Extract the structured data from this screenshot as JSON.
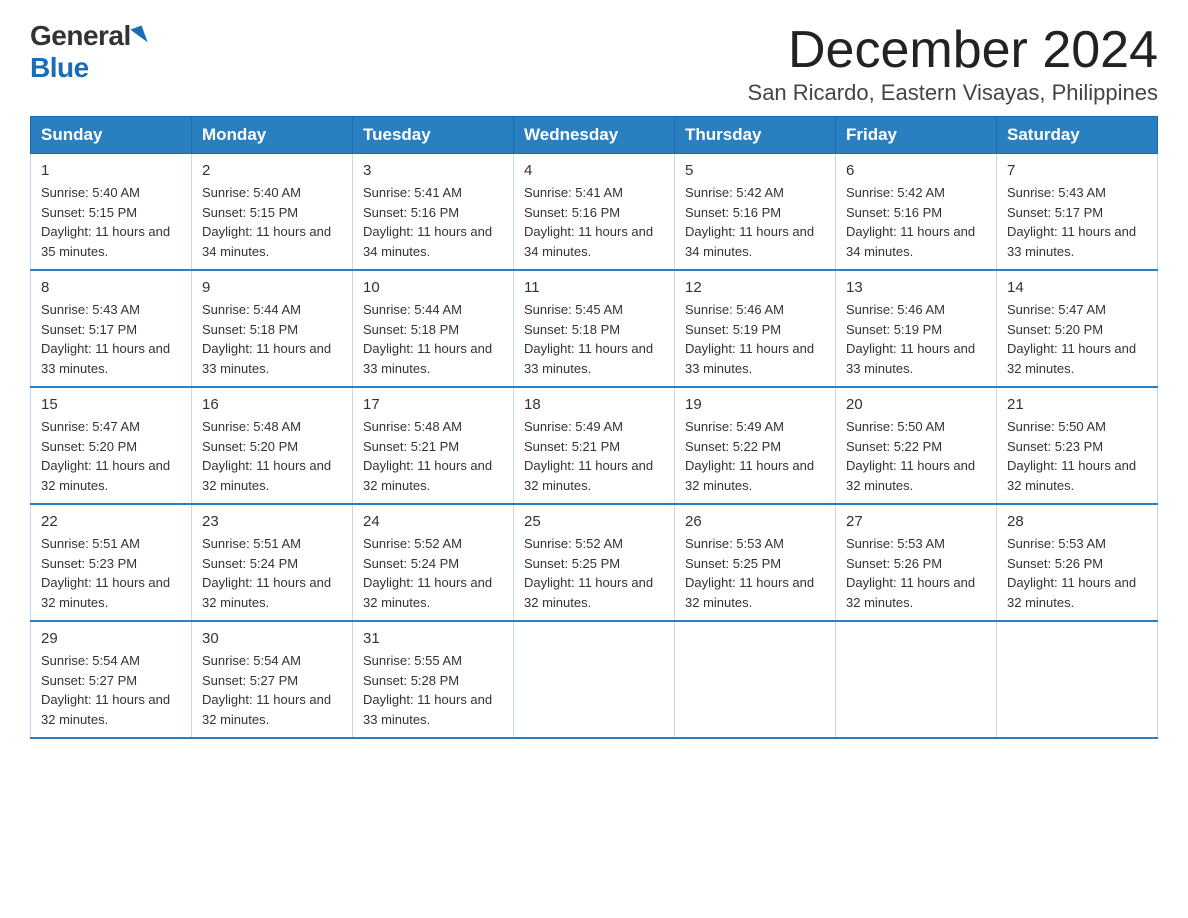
{
  "logo": {
    "general": "General",
    "blue": "Blue"
  },
  "title": "December 2024",
  "location": "San Ricardo, Eastern Visayas, Philippines",
  "days_of_week": [
    "Sunday",
    "Monday",
    "Tuesday",
    "Wednesday",
    "Thursday",
    "Friday",
    "Saturday"
  ],
  "weeks": [
    [
      {
        "day": "1",
        "sunrise": "5:40 AM",
        "sunset": "5:15 PM",
        "daylight": "11 hours and 35 minutes."
      },
      {
        "day": "2",
        "sunrise": "5:40 AM",
        "sunset": "5:15 PM",
        "daylight": "11 hours and 34 minutes."
      },
      {
        "day": "3",
        "sunrise": "5:41 AM",
        "sunset": "5:16 PM",
        "daylight": "11 hours and 34 minutes."
      },
      {
        "day": "4",
        "sunrise": "5:41 AM",
        "sunset": "5:16 PM",
        "daylight": "11 hours and 34 minutes."
      },
      {
        "day": "5",
        "sunrise": "5:42 AM",
        "sunset": "5:16 PM",
        "daylight": "11 hours and 34 minutes."
      },
      {
        "day": "6",
        "sunrise": "5:42 AM",
        "sunset": "5:16 PM",
        "daylight": "11 hours and 34 minutes."
      },
      {
        "day": "7",
        "sunrise": "5:43 AM",
        "sunset": "5:17 PM",
        "daylight": "11 hours and 33 minutes."
      }
    ],
    [
      {
        "day": "8",
        "sunrise": "5:43 AM",
        "sunset": "5:17 PM",
        "daylight": "11 hours and 33 minutes."
      },
      {
        "day": "9",
        "sunrise": "5:44 AM",
        "sunset": "5:18 PM",
        "daylight": "11 hours and 33 minutes."
      },
      {
        "day": "10",
        "sunrise": "5:44 AM",
        "sunset": "5:18 PM",
        "daylight": "11 hours and 33 minutes."
      },
      {
        "day": "11",
        "sunrise": "5:45 AM",
        "sunset": "5:18 PM",
        "daylight": "11 hours and 33 minutes."
      },
      {
        "day": "12",
        "sunrise": "5:46 AM",
        "sunset": "5:19 PM",
        "daylight": "11 hours and 33 minutes."
      },
      {
        "day": "13",
        "sunrise": "5:46 AM",
        "sunset": "5:19 PM",
        "daylight": "11 hours and 33 minutes."
      },
      {
        "day": "14",
        "sunrise": "5:47 AM",
        "sunset": "5:20 PM",
        "daylight": "11 hours and 32 minutes."
      }
    ],
    [
      {
        "day": "15",
        "sunrise": "5:47 AM",
        "sunset": "5:20 PM",
        "daylight": "11 hours and 32 minutes."
      },
      {
        "day": "16",
        "sunrise": "5:48 AM",
        "sunset": "5:20 PM",
        "daylight": "11 hours and 32 minutes."
      },
      {
        "day": "17",
        "sunrise": "5:48 AM",
        "sunset": "5:21 PM",
        "daylight": "11 hours and 32 minutes."
      },
      {
        "day": "18",
        "sunrise": "5:49 AM",
        "sunset": "5:21 PM",
        "daylight": "11 hours and 32 minutes."
      },
      {
        "day": "19",
        "sunrise": "5:49 AM",
        "sunset": "5:22 PM",
        "daylight": "11 hours and 32 minutes."
      },
      {
        "day": "20",
        "sunrise": "5:50 AM",
        "sunset": "5:22 PM",
        "daylight": "11 hours and 32 minutes."
      },
      {
        "day": "21",
        "sunrise": "5:50 AM",
        "sunset": "5:23 PM",
        "daylight": "11 hours and 32 minutes."
      }
    ],
    [
      {
        "day": "22",
        "sunrise": "5:51 AM",
        "sunset": "5:23 PM",
        "daylight": "11 hours and 32 minutes."
      },
      {
        "day": "23",
        "sunrise": "5:51 AM",
        "sunset": "5:24 PM",
        "daylight": "11 hours and 32 minutes."
      },
      {
        "day": "24",
        "sunrise": "5:52 AM",
        "sunset": "5:24 PM",
        "daylight": "11 hours and 32 minutes."
      },
      {
        "day": "25",
        "sunrise": "5:52 AM",
        "sunset": "5:25 PM",
        "daylight": "11 hours and 32 minutes."
      },
      {
        "day": "26",
        "sunrise": "5:53 AM",
        "sunset": "5:25 PM",
        "daylight": "11 hours and 32 minutes."
      },
      {
        "day": "27",
        "sunrise": "5:53 AM",
        "sunset": "5:26 PM",
        "daylight": "11 hours and 32 minutes."
      },
      {
        "day": "28",
        "sunrise": "5:53 AM",
        "sunset": "5:26 PM",
        "daylight": "11 hours and 32 minutes."
      }
    ],
    [
      {
        "day": "29",
        "sunrise": "5:54 AM",
        "sunset": "5:27 PM",
        "daylight": "11 hours and 32 minutes."
      },
      {
        "day": "30",
        "sunrise": "5:54 AM",
        "sunset": "5:27 PM",
        "daylight": "11 hours and 32 minutes."
      },
      {
        "day": "31",
        "sunrise": "5:55 AM",
        "sunset": "5:28 PM",
        "daylight": "11 hours and 33 minutes."
      },
      null,
      null,
      null,
      null
    ]
  ]
}
